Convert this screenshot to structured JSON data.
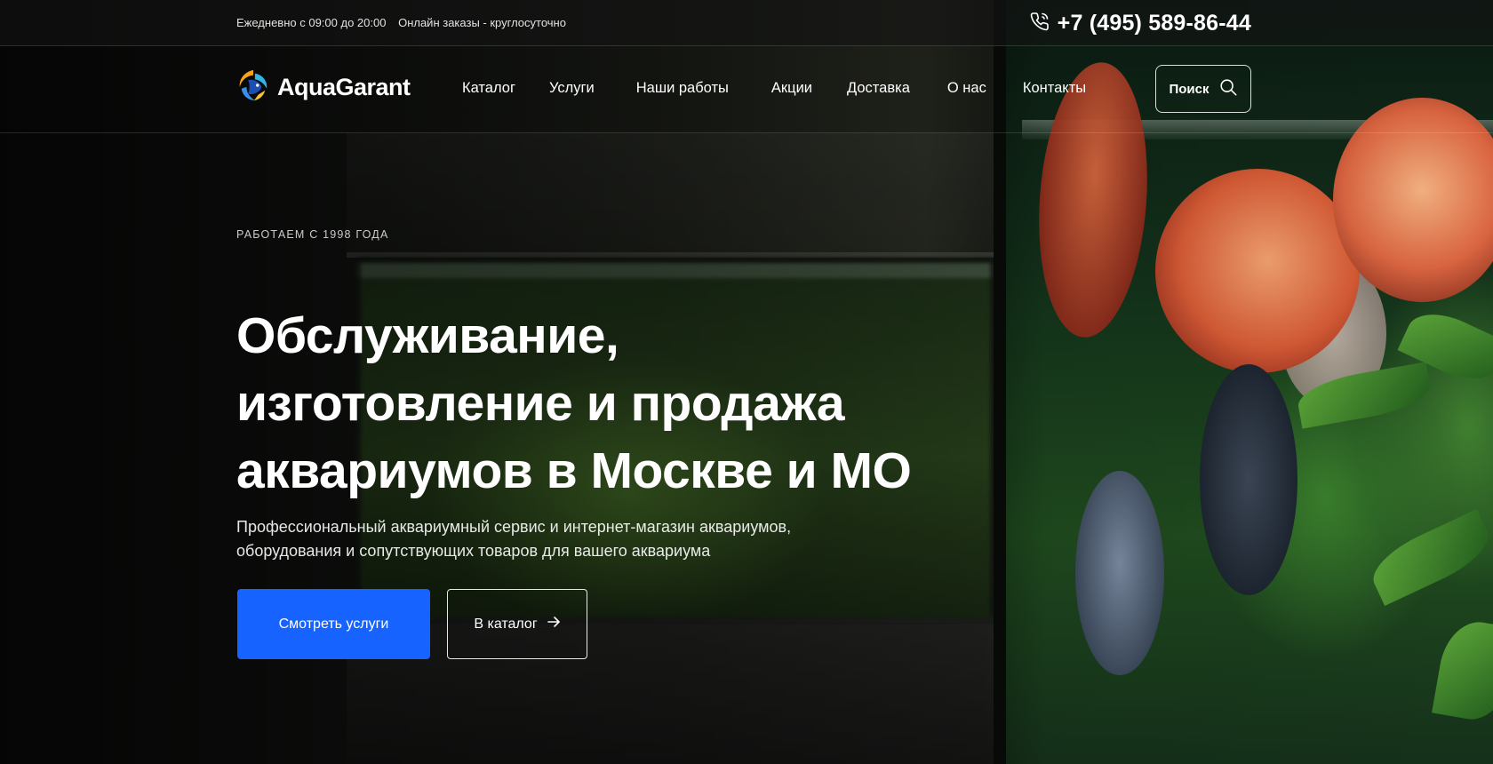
{
  "topbar": {
    "hours": "Ежедневно с 09:00 до 20:00",
    "online_orders": "Онлайн заказы - круглосуточно",
    "phone": "+7 (495) 589-86-44",
    "phone_icon": "phone-icon"
  },
  "header": {
    "logo_text": "AquaGarant",
    "logo_icon": "fish-logo-icon",
    "menu": [
      {
        "label": "Каталог"
      },
      {
        "label": "Услуги"
      },
      {
        "label": "Наши работы"
      },
      {
        "label": "Акции"
      },
      {
        "label": "Доставка"
      },
      {
        "label": "О нас"
      },
      {
        "label": "Контакты"
      }
    ],
    "search_label": "Поиск",
    "search_icon": "search-icon"
  },
  "hero": {
    "kicker": "РАБОТАЕМ С 1998 ГОДА",
    "headline_lines": [
      "Обслуживание,",
      "изготовление и продажа",
      "аквариумов в Москве и МО"
    ],
    "subtitle_lines": [
      "Профессиональный аквариумный сервис и интернет-магазин аквариумов,",
      "оборудования и сопутствующих товаров для вашего аквариума"
    ],
    "primary_button": "Смотреть услуги",
    "secondary_button": "В каталог",
    "secondary_icon": "arrow-right-icon"
  },
  "colors": {
    "accent": "#1763ff",
    "text": "#ffffff"
  }
}
